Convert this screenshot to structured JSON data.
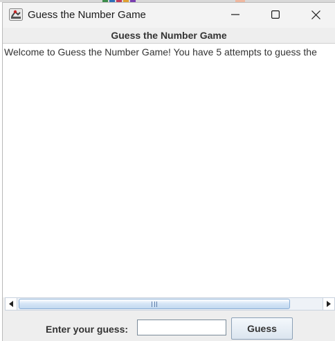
{
  "window": {
    "title": "Guess the Number Game",
    "icon": "java-app-icon",
    "controls": [
      "minimize-icon",
      "maximize-icon",
      "close-icon"
    ]
  },
  "header": {
    "title": "Guess the Number Game"
  },
  "output": {
    "text": "Welcome to Guess the Number Game! You have 5 attempts to guess the"
  },
  "scrollbar": {
    "orientation": "horizontal"
  },
  "input_bar": {
    "label": "Enter your guess:",
    "guess_value": "",
    "button_label": "Guess"
  },
  "colors": {
    "titlebar": "#f3f3f3",
    "panel": "#eeeeee",
    "scroll_thumb": "#c2d8f0",
    "text": "#333333"
  }
}
